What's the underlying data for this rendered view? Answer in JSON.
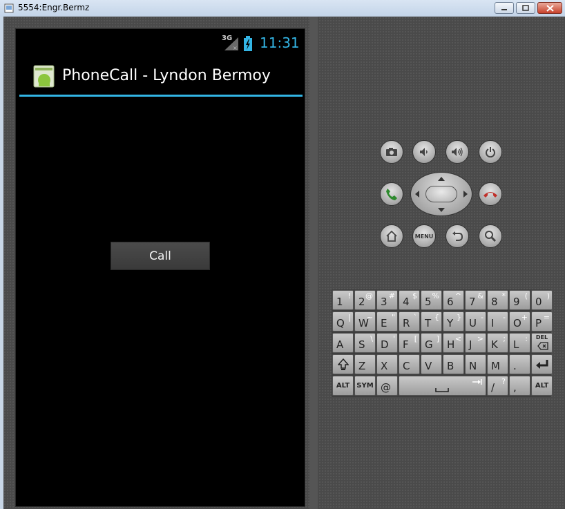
{
  "window": {
    "title": "5554:Engr.Bermz"
  },
  "status_bar": {
    "network": "3G",
    "time": "11:31"
  },
  "app": {
    "title": "PhoneCall - Lyndon Bermoy",
    "call_button": "Call"
  },
  "hardware": {
    "menu_label": "MENU",
    "buttons": [
      "camera",
      "volume-down",
      "volume-up",
      "power",
      "call",
      "end-call",
      "home",
      "menu",
      "back",
      "search"
    ]
  },
  "keyboard": {
    "row1": [
      {
        "key": "1",
        "alt": "!"
      },
      {
        "key": "2",
        "alt": "@"
      },
      {
        "key": "3",
        "alt": "#"
      },
      {
        "key": "4",
        "alt": "$"
      },
      {
        "key": "5",
        "alt": "%"
      },
      {
        "key": "6",
        "alt": "^"
      },
      {
        "key": "7",
        "alt": "&"
      },
      {
        "key": "8",
        "alt": "*"
      },
      {
        "key": "9",
        "alt": "("
      },
      {
        "key": "0",
        "alt": ")"
      }
    ],
    "row2": [
      {
        "key": "Q",
        "alt": "|"
      },
      {
        "key": "W",
        "alt": "~"
      },
      {
        "key": "E",
        "alt": "\""
      },
      {
        "key": "R",
        "alt": "`"
      },
      {
        "key": "T",
        "alt": "{"
      },
      {
        "key": "Y",
        "alt": "}"
      },
      {
        "key": "U",
        "alt": "-"
      },
      {
        "key": "I",
        "alt": "-"
      },
      {
        "key": "O",
        "alt": "+"
      },
      {
        "key": "P",
        "alt": "="
      }
    ],
    "row3": [
      {
        "key": "A",
        "alt": ""
      },
      {
        "key": "S",
        "alt": "\\"
      },
      {
        "key": "D",
        "alt": "'"
      },
      {
        "key": "F",
        "alt": "["
      },
      {
        "key": "G",
        "alt": "]"
      },
      {
        "key": "H",
        "alt": "<"
      },
      {
        "key": "J",
        "alt": ">"
      },
      {
        "key": "K",
        "alt": ";"
      },
      {
        "key": "L",
        "alt": ":"
      }
    ],
    "del_label": "DEL",
    "row4": [
      "Z",
      "X",
      "C",
      "V",
      "B",
      "N",
      "M",
      "."
    ],
    "alt_label": "ALT",
    "sym_label": "SYM",
    "at_label": "@",
    "slash": {
      "key": "/",
      "alt": "?"
    },
    "comma": ","
  },
  "colors": {
    "holo_blue": "#33b5e5",
    "screen_bg": "#000000",
    "emulator_bg": "#4a4a4a"
  }
}
